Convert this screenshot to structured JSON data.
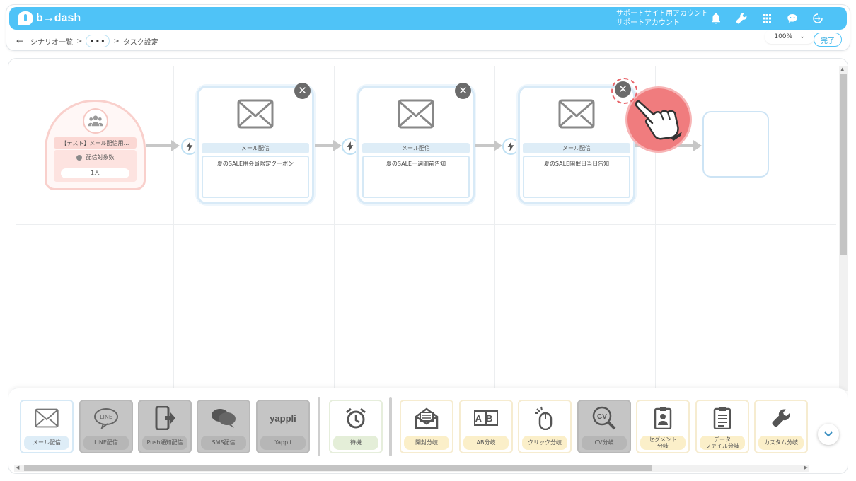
{
  "app": {
    "logo_text": "b→dash",
    "account_line1": "サポートサイト用アカウント",
    "account_line2": "サポートアカウント"
  },
  "header": {
    "icons": [
      "bell-icon",
      "wrench-icon",
      "grid-icon",
      "support-bot-icon",
      "logout-icon"
    ],
    "back_label": "←",
    "breadcrumb_scenario": "シナリオ一覧",
    "breadcrumb_sep": ">",
    "breadcrumb_more": "•••",
    "breadcrumb_current": "タスク設定",
    "zoom_value": "100%",
    "done_label": "完了"
  },
  "start_node": {
    "title": "【テスト】メール配信用…",
    "target_label": "配信対象数",
    "count": "1人"
  },
  "mail_nodes": [
    {
      "label": "メール配信",
      "desc": "夏のSALE用会員限定クーポン"
    },
    {
      "label": "メール配信",
      "desc": "夏のSALE一週間前告知"
    },
    {
      "label": "メール配信",
      "desc": "夏のSALE開催日当日告知"
    }
  ],
  "palette": {
    "tools": [
      {
        "label": "メール配信",
        "icon": "envelope-icon"
      },
      {
        "label": "LINE配信",
        "icon": "line-icon",
        "icon_text": "LINE"
      },
      {
        "label": "Push通知配信",
        "icon": "push-phone-icon"
      },
      {
        "label": "SMS配信",
        "icon": "chat-bubbles-icon"
      },
      {
        "label": "Yappli",
        "icon": "yappli-icon",
        "icon_text": "yappli"
      },
      {
        "label": "待機",
        "icon": "alarm-clock-icon"
      },
      {
        "label": "開封分岐",
        "icon": "open-envelope-icon"
      },
      {
        "label": "AB分岐",
        "icon": "ab-icon",
        "icon_text": "AB"
      },
      {
        "label": "クリック分岐",
        "icon": "mouse-icon"
      },
      {
        "label": "CV分岐",
        "icon": "cv-search-icon",
        "icon_text": "CV"
      },
      {
        "label": "セグメント\n分岐",
        "icon": "id-badge-icon"
      },
      {
        "label": "データ\nファイル分岐",
        "icon": "clipboard-icon"
      },
      {
        "label": "カスタム分岐",
        "icon": "wrench-icon"
      }
    ]
  },
  "colors": {
    "accent": "#4fc3f7",
    "start_border": "#f9d0cc",
    "highlight": "#f07c7e"
  }
}
